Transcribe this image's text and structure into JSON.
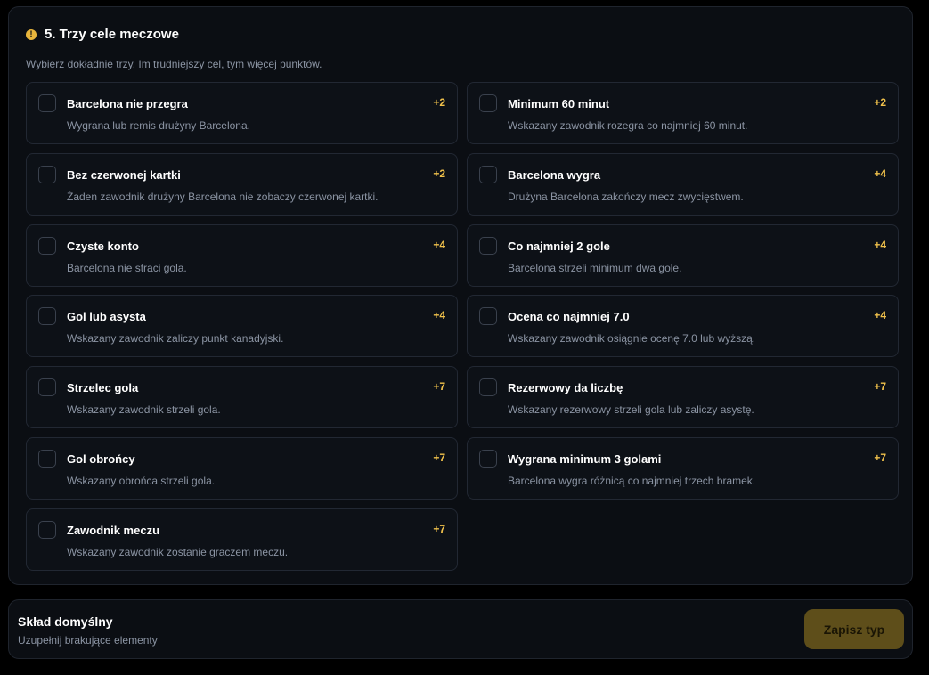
{
  "section": {
    "number_icon": "5",
    "title": "5. Trzy cele meczowe",
    "subtitle": "Wybierz dokładnie trzy. Im trudniejszy cel, tym więcej punktów."
  },
  "goals": [
    {
      "title": "Barcelona nie przegra",
      "desc": "Wygrana lub remis drużyny Barcelona.",
      "points": "+2"
    },
    {
      "title": "Minimum 60 minut",
      "desc": "Wskazany zawodnik rozegra co najmniej 60 minut.",
      "points": "+2"
    },
    {
      "title": "Bez czerwonej kartki",
      "desc": "Żaden zawodnik drużyny Barcelona nie zobaczy czerwonej kartki.",
      "points": "+2"
    },
    {
      "title": "Barcelona wygra",
      "desc": "Drużyna Barcelona zakończy mecz zwycięstwem.",
      "points": "+4"
    },
    {
      "title": "Czyste konto",
      "desc": "Barcelona nie straci gola.",
      "points": "+4"
    },
    {
      "title": "Co najmniej 2 gole",
      "desc": "Barcelona strzeli minimum dwa gole.",
      "points": "+4"
    },
    {
      "title": "Gol lub asysta",
      "desc": "Wskazany zawodnik zaliczy punkt kanadyjski.",
      "points": "+4"
    },
    {
      "title": "Ocena co najmniej 7.0",
      "desc": "Wskazany zawodnik osiągnie ocenę 7.0 lub wyższą.",
      "points": "+4"
    },
    {
      "title": "Strzelec gola",
      "desc": "Wskazany zawodnik strzeli gola.",
      "points": "+7"
    },
    {
      "title": "Rezerwowy da liczbę",
      "desc": "Wskazany rezerwowy strzeli gola lub zaliczy asystę.",
      "points": "+7"
    },
    {
      "title": "Gol obrońcy",
      "desc": "Wskazany obrońca strzeli gola.",
      "points": "+7"
    },
    {
      "title": "Wygrana minimum 3 golami",
      "desc": "Barcelona wygra różnicą co najmniej trzech bramek.",
      "points": "+7"
    },
    {
      "title": "Zawodnik meczu",
      "desc": "Wskazany zawodnik zostanie graczem meczu.",
      "points": "+7"
    }
  ],
  "footer": {
    "title": "Skład domyślny",
    "subtitle": "Uzupełnij brakujące elementy",
    "save_label": "Zapisz typ"
  },
  "colors": {
    "accent": "#f0c14b",
    "button_disabled": "#5e4e1a"
  }
}
